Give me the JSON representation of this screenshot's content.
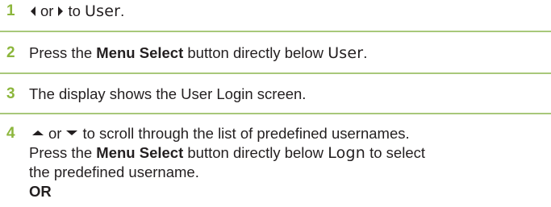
{
  "steps": [
    {
      "number": "1",
      "parts": {
        "or": "or",
        "to": "to",
        "target": "User",
        "end": "."
      }
    },
    {
      "number": "2",
      "parts": {
        "pre": "Press the",
        "key": "Menu Select",
        "mid": "button directly below",
        "softkey": "User",
        "end": "."
      }
    },
    {
      "number": "3",
      "text": "The display shows the User Login screen."
    },
    {
      "number": "4",
      "parts": {
        "or": "or",
        "scroll": "to scroll through the list of predefined usernames.",
        "pre": "Press the",
        "key": "Menu Select",
        "mid": "button directly below",
        "softkey": "Logn",
        "post": "to select",
        "line3": "the predefined username.",
        "or_label": "OR"
      }
    }
  ],
  "icons": {
    "step1_left": "left-arrow-icon",
    "step1_right": "right-arrow-icon",
    "step4_up": "up-arrow-icon",
    "step4_down": "down-arrow-icon"
  },
  "colors": {
    "step_number": "#8cb63c",
    "rule": "#a8c87a",
    "text": "#231f20"
  }
}
